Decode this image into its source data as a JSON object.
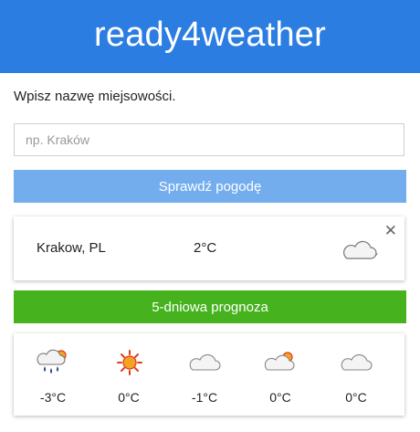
{
  "header": {
    "title": "ready4weather"
  },
  "search": {
    "label": "Wpisz nazwę miejsowości.",
    "placeholder": "np. Kraków",
    "button_label": "Sprawdź pogodę"
  },
  "current": {
    "city": "Krakow, PL",
    "temperature": "2°C",
    "icon": "cloud-moon-icon",
    "close_label": "✕"
  },
  "forecast_button_label": "5-dniowa prognoza",
  "forecast": [
    {
      "icon": "rain-sun-cloud-icon",
      "temperature": "-3°C"
    },
    {
      "icon": "sun-icon",
      "temperature": "0°C"
    },
    {
      "icon": "cloud-icon",
      "temperature": "-1°C"
    },
    {
      "icon": "cloud-sun-icon",
      "temperature": "0°C"
    },
    {
      "icon": "cloud-icon",
      "temperature": "0°C"
    }
  ],
  "colors": {
    "header": "#2b7de1",
    "check_button": "#74adee",
    "forecast_button": "#45b21e"
  }
}
